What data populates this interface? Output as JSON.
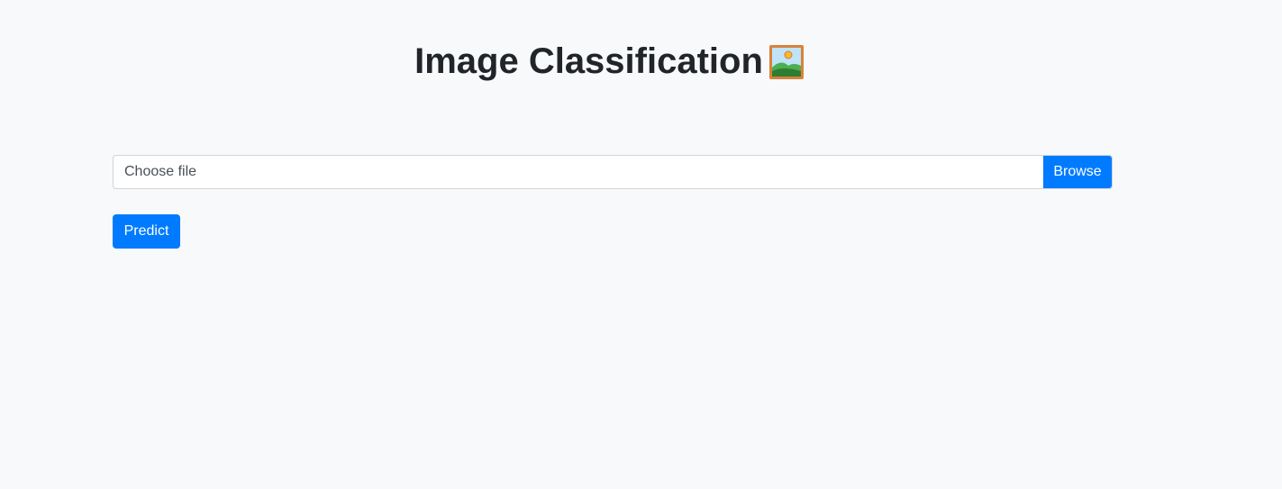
{
  "header": {
    "title": "Image Classification",
    "title_icon": "framed-picture-icon"
  },
  "upload": {
    "placeholder": "Choose file",
    "browse_label": "Browse"
  },
  "actions": {
    "predict_label": "Predict"
  },
  "colors": {
    "background": "#f8f9fa",
    "primary": "#007bff",
    "text": "#212529",
    "input_border": "#ced4da"
  }
}
